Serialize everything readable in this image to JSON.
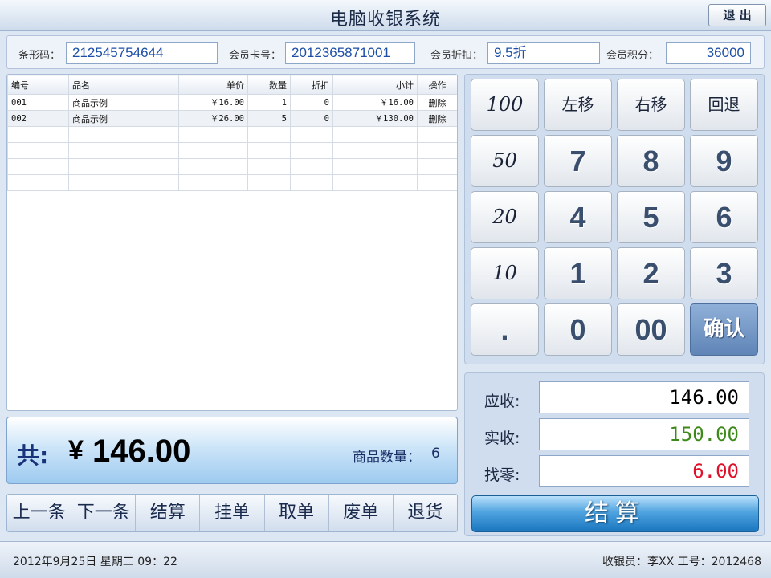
{
  "window": {
    "title": "电脑收银系统",
    "exit_label": "退 出"
  },
  "info": {
    "barcode_label": "条形码：",
    "barcode_value": "212545754644",
    "card_label": "会员卡号：",
    "card_value": "2012365871001",
    "discount_label": "会员折扣：",
    "discount_value": "9.5折",
    "points_label": "会员积分：",
    "points_value": "36000"
  },
  "table": {
    "headers": [
      "编号",
      "品名",
      "单价",
      "数量",
      "折扣",
      "小计",
      "操作"
    ],
    "rows": [
      [
        "001",
        "商品示例",
        "￥16.00",
        "1",
        "0",
        "￥16.00",
        "删除"
      ],
      [
        "002",
        "商品示例",
        "￥26.00",
        "5",
        "0",
        "￥130.00",
        "删除"
      ]
    ]
  },
  "total": {
    "label": "共:",
    "symbol": "¥",
    "value": "146.00",
    "count_label": "商品数量：",
    "count_value": "6"
  },
  "actions": [
    "上一条",
    "下一条",
    "结算",
    "挂单",
    "取单",
    "废单",
    "退货"
  ],
  "keypad": {
    "denoms": [
      "100",
      "50",
      "20",
      "10"
    ],
    "funcs": [
      "左移",
      "右移",
      "回退"
    ],
    "digits": [
      "7",
      "8",
      "9",
      "4",
      "5",
      "6",
      "1",
      "2",
      "3"
    ],
    "dot": ".",
    "zero": "0",
    "double_zero": "00",
    "confirm": "确认"
  },
  "payment": {
    "due_label": "应收:",
    "due_value": "146.00",
    "paid_label": "实收:",
    "paid_value": "150.00",
    "change_label": "找零:",
    "change_value": "6.00",
    "settle_label": "结算"
  },
  "status": {
    "datetime": "2012年9月25日  星期二  09：22",
    "cashier": "收银员：李XX  工号：2012468"
  },
  "colors": {
    "paid": "#3d8a1a",
    "change": "#e0102a",
    "accent": "#1a76bf"
  }
}
